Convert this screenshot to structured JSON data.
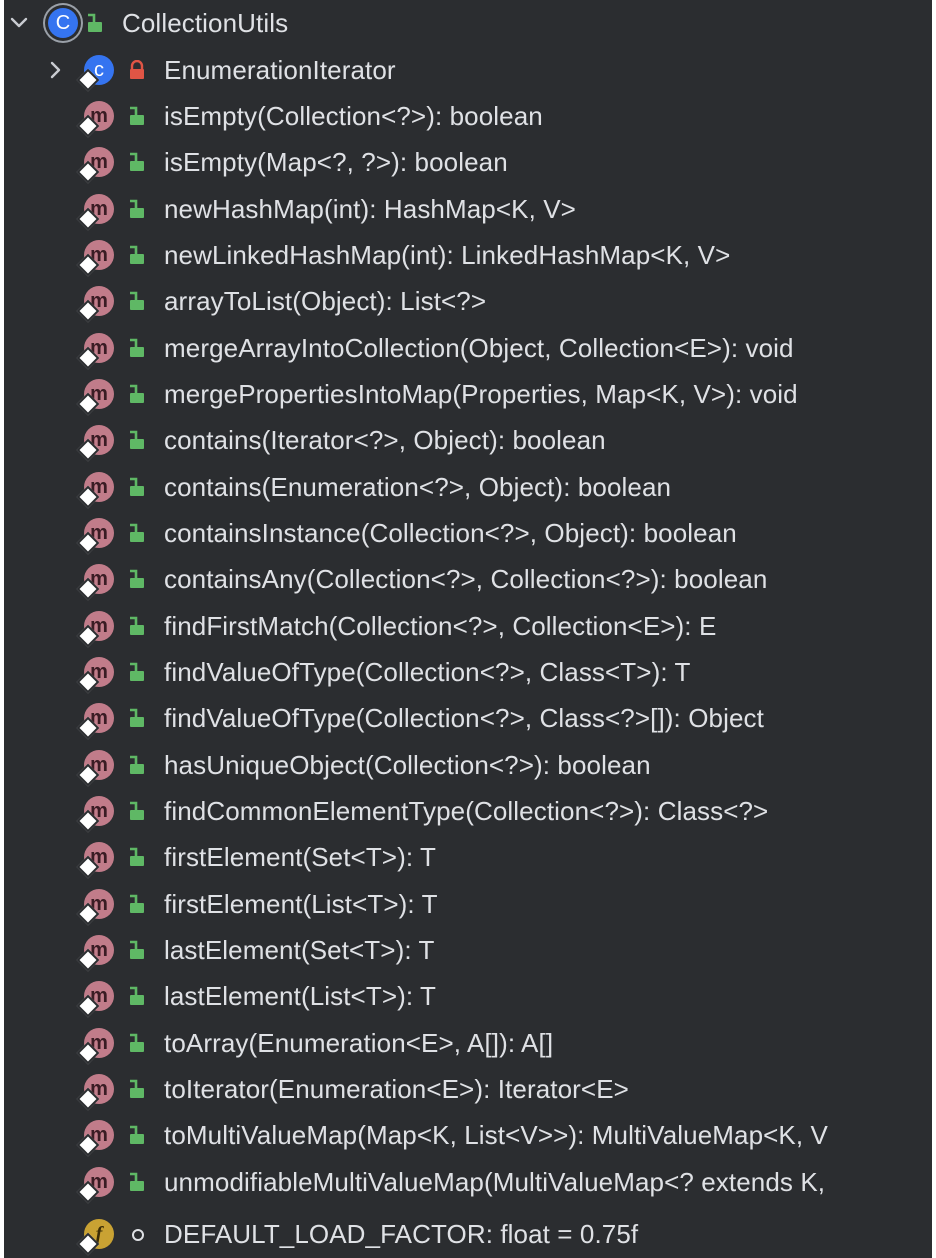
{
  "class_node": {
    "label": "CollectionUtils",
    "icon": "class-icon",
    "icon_letter": "C",
    "visibility_icon": "public-lock-open-icon",
    "expanded": true
  },
  "inner_class": {
    "label": "EnumerationIterator",
    "icon": "class-icon",
    "icon_letter": "c",
    "visibility_icon": "private-lock-icon",
    "expanded": false
  },
  "methods": [
    "isEmpty(Collection<?>): boolean",
    "isEmpty(Map<?, ?>): boolean",
    "newHashMap(int): HashMap<K, V>",
    "newLinkedHashMap(int): LinkedHashMap<K, V>",
    "arrayToList(Object): List<?>",
    "mergeArrayIntoCollection(Object, Collection<E>): void",
    "mergePropertiesIntoMap(Properties, Map<K, V>): void",
    "contains(Iterator<?>, Object): boolean",
    "contains(Enumeration<?>, Object): boolean",
    "containsInstance(Collection<?>, Object): boolean",
    "containsAny(Collection<?>, Collection<?>): boolean",
    "findFirstMatch(Collection<?>, Collection<E>): E",
    "findValueOfType(Collection<?>, Class<T>): T",
    "findValueOfType(Collection<?>, Class<?>[]): Object",
    "hasUniqueObject(Collection<?>): boolean",
    "findCommonElementType(Collection<?>): Class<?>",
    "firstElement(Set<T>): T",
    "firstElement(List<T>): T",
    "lastElement(Set<T>): T",
    "lastElement(List<T>): T",
    "toArray(Enumeration<E>, A[]): A[]",
    "toIterator(Enumeration<E>): Iterator<E>",
    "toMultiValueMap(Map<K, List<V>>): MultiValueMap<K, V",
    "unmodifiableMultiValueMap(MultiValueMap<? extends K,"
  ],
  "method_icon": {
    "name": "method-icon",
    "letter": "m",
    "visibility_icon": "public-lock-open-icon"
  },
  "field": {
    "label": "DEFAULT_LOAD_FACTOR: float = 0.75f",
    "icon": "field-icon",
    "icon_letter": "f",
    "visibility_icon": "package-private-dot-icon"
  },
  "colors": {
    "background": "#2b2d30",
    "text": "#dfe1e5",
    "class_icon": "#3574f0",
    "method_icon": "#c17c8a",
    "field_icon": "#c9a233",
    "public_lock": "#5fb865",
    "private_lock": "#e05545"
  }
}
